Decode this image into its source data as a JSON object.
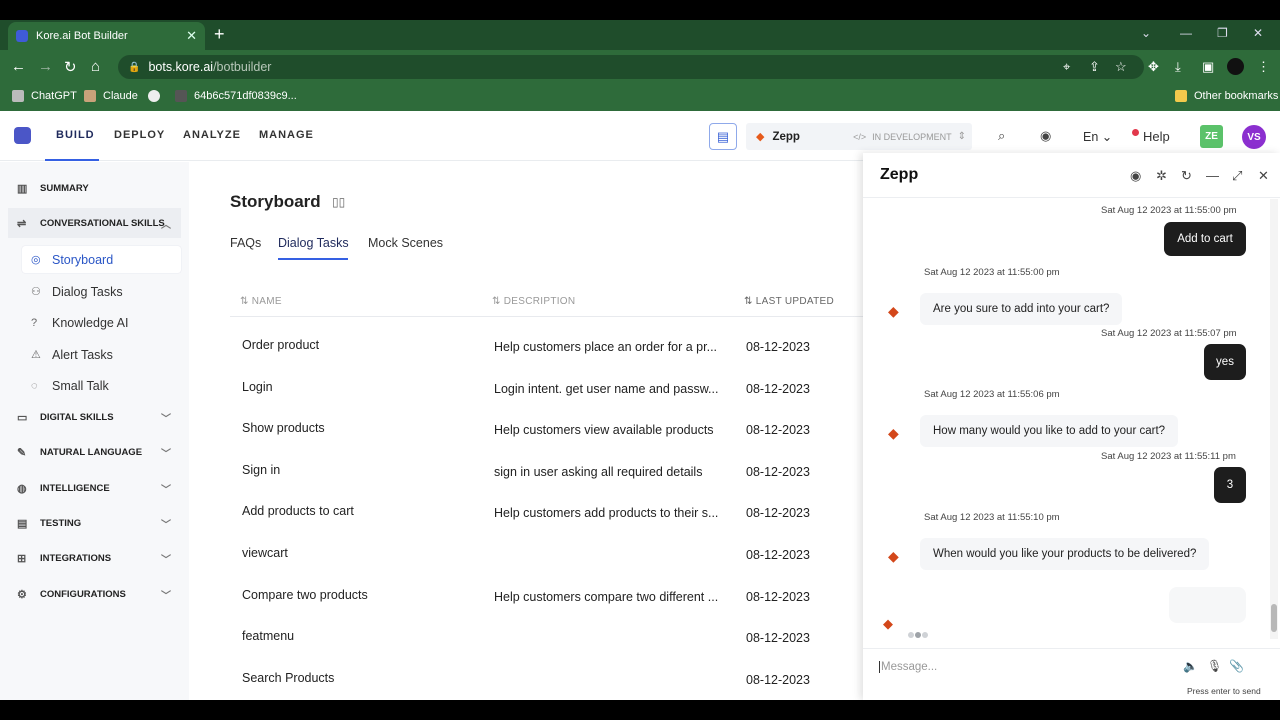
{
  "browser": {
    "tab_title": "Kore.ai Bot Builder",
    "url_domain": "bots.kore.ai",
    "url_path": "/botbuilder",
    "bookmarks": [
      "ChatGPT",
      "Claude",
      "64b6c571df0839c9..."
    ],
    "other_bookmarks": "Other bookmarks"
  },
  "topnav": {
    "items": [
      "BUILD",
      "DEPLOY",
      "ANALYZE",
      "MANAGE"
    ],
    "bot_name": "Zepp",
    "bot_status": "IN DEVELOPMENT",
    "language": "En",
    "help": "Help",
    "user_initials_1": "ZE",
    "user_initials_2": "VS"
  },
  "sidebar": {
    "summary": "SUMMARY",
    "conversational": "CONVERSATIONAL SKILLS",
    "sub_items": [
      "Storyboard",
      "Dialog Tasks",
      "Knowledge AI",
      "Alert Tasks",
      "Small Talk"
    ],
    "groups": [
      "DIGITAL SKILLS",
      "NATURAL LANGUAGE",
      "INTELLIGENCE",
      "TESTING",
      "INTEGRATIONS",
      "CONFIGURATIONS"
    ]
  },
  "main": {
    "title": "Storyboard",
    "tabs": [
      "FAQs",
      "Dialog Tasks",
      "Mock Scenes"
    ],
    "columns": [
      "NAME",
      "DESCRIPTION",
      "LAST UPDATED"
    ],
    "rows": [
      {
        "name": "Order product",
        "description": "Help customers place an order for a pr...",
        "updated": "08-12-2023"
      },
      {
        "name": "Login",
        "description": "Login intent. get user name and passw...",
        "updated": "08-12-2023"
      },
      {
        "name": "Show products",
        "description": "Help customers view available products",
        "updated": "08-12-2023"
      },
      {
        "name": "Sign in",
        "description": "sign in user asking all required details",
        "updated": "08-12-2023"
      },
      {
        "name": "Add products to cart",
        "description": "Help customers add products to their s...",
        "updated": "08-12-2023"
      },
      {
        "name": "viewcart",
        "description": "",
        "updated": "08-12-2023"
      },
      {
        "name": "Compare two products",
        "description": "Help customers compare two different ...",
        "updated": "08-12-2023"
      },
      {
        "name": "featmenu",
        "description": "",
        "updated": "08-12-2023"
      },
      {
        "name": "Search Products",
        "description": "",
        "updated": "08-12-2023"
      }
    ]
  },
  "chat": {
    "title": "Zepp",
    "messages": [
      {
        "from": "user",
        "time": "Sat Aug 12 2023 at 11:55:00 pm",
        "text": "Add to cart"
      },
      {
        "from": "bot",
        "time": "Sat Aug 12 2023 at 11:55:00 pm",
        "text": "Are you sure to add into your cart?"
      },
      {
        "from": "user",
        "time": "Sat Aug 12 2023 at 11:55:07 pm",
        "text": "yes"
      },
      {
        "from": "bot",
        "time": "Sat Aug 12 2023 at 11:55:06 pm",
        "text": "How many would you like to add to your cart?"
      },
      {
        "from": "user",
        "time": "Sat Aug 12 2023 at 11:55:11 pm",
        "text": "3"
      },
      {
        "from": "bot",
        "time": "Sat Aug 12 2023 at 11:55:10 pm",
        "text": "When would you like your products to be delivered?"
      }
    ],
    "placeholder": "Message...",
    "hint": "Press enter to send"
  },
  "colors": {
    "accent": "#3560e3",
    "chrome_green": "#2e6b3a",
    "bot_icon": "#d3471a"
  }
}
